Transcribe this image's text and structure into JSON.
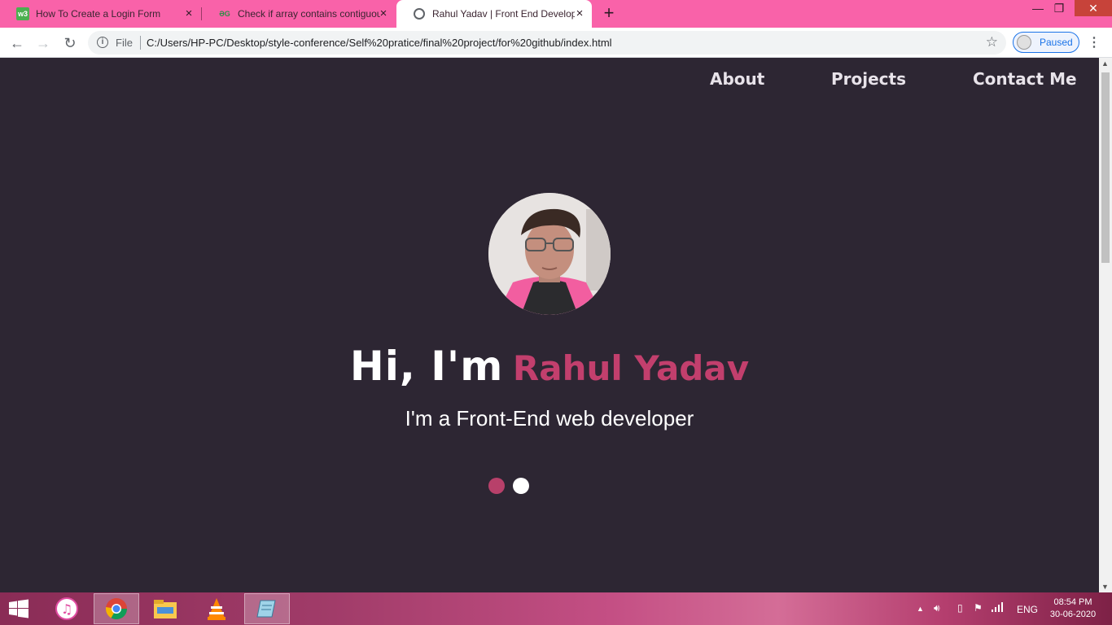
{
  "browser": {
    "tabs": [
      {
        "title": "How To Create a Login Form",
        "favicon": "w3schools-icon"
      },
      {
        "title": "Check if array contains contiguous",
        "favicon": "geeksforgeeks-icon"
      },
      {
        "title": "Rahul Yadav | Front End Developer",
        "favicon": "globe-icon"
      }
    ],
    "address": {
      "scheme_label": "File",
      "url": "C:/Users/HP-PC/Desktop/style-conference/Self%20pratice/final%20project/for%20github/index.html"
    },
    "profile_status": "Paused"
  },
  "site": {
    "nav": [
      "About",
      "Projects",
      "Contact Me"
    ],
    "greeting": "Hi, I'm",
    "name": "Rahul Yadav",
    "tagline": "I'm a Front-End web developer",
    "carousel": {
      "count": 2,
      "active_index": 0
    },
    "colors": {
      "background": "#2d2633",
      "accent": "#c23f6d",
      "text": "#ffffff"
    }
  },
  "taskbar": {
    "apps": [
      "itunes-icon",
      "chrome-icon",
      "file-explorer-icon",
      "vlc-icon",
      "notepad-icon"
    ],
    "tray": {
      "language": "ENG",
      "time": "08:54 PM",
      "date": "30-06-2020"
    }
  }
}
